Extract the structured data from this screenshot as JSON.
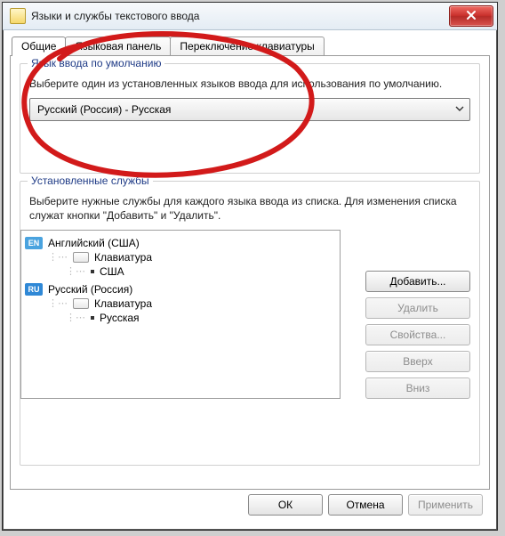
{
  "window": {
    "title": "Языки и службы текстового ввода"
  },
  "tabs": {
    "general": "Общие",
    "langbar": "Языковая панель",
    "switch": "Переключение клавиатуры"
  },
  "group_default": {
    "title": "Язык ввода по умолчанию",
    "desc": "Выберите один из установленных языков ввода для использования по умолчанию.",
    "dropdown": "Русский (Россия) - Русская"
  },
  "group_services": {
    "title": "Установленные службы",
    "desc": "Выберите нужные службы для каждого языка ввода из списка. Для изменения списка служат кнопки \"Добавить\" и \"Удалить\"."
  },
  "langs": {
    "en_badge": "EN",
    "en_name": "Английский (США)",
    "en_kbd_label": "Клавиатура",
    "en_layout": "США",
    "ru_badge": "RU",
    "ru_name": "Русский (Россия)",
    "ru_kbd_label": "Клавиатура",
    "ru_layout": "Русская"
  },
  "side_buttons": {
    "add": "Добавить...",
    "remove": "Удалить",
    "props": "Свойства...",
    "up": "Вверх",
    "down": "Вниз"
  },
  "footer": {
    "ok": "ОК",
    "cancel": "Отмена",
    "apply": "Применить"
  }
}
